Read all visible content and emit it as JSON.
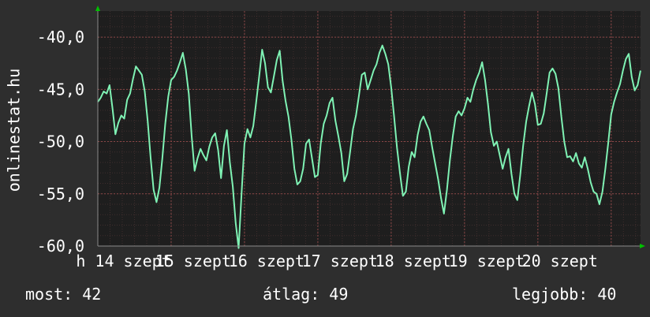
{
  "chart_data": {
    "type": "line",
    "vertical_label": "onlinestat.hu",
    "y_tick_labels": [
      "-40,0",
      "-45,0",
      "-50,0",
      "-55,0",
      "-60,0"
    ],
    "x_tick_labels": [
      "h 14 szept",
      "15 szept",
      "16 szept",
      "17 szept",
      "18 szept",
      "19 szept",
      "20 szept"
    ],
    "ylim": [
      -60,
      -37.5
    ],
    "grid": true,
    "colors": {
      "background": "#2e2e2e",
      "plot": "#1e1e1e",
      "grid": "#5a3b3b",
      "line": "#7ff2b4",
      "text": "#ffffff",
      "axis_arrow": "#00c000"
    },
    "x": [
      0.0,
      0.04,
      0.08,
      0.12,
      0.16,
      0.2,
      0.24,
      0.28,
      0.32,
      0.36,
      0.4,
      0.44,
      0.48,
      0.52,
      0.56,
      0.6,
      0.64,
      0.68,
      0.72,
      0.76,
      0.8,
      0.84,
      0.88,
      0.92,
      0.96,
      1.0,
      1.04,
      1.08,
      1.12,
      1.16,
      1.2,
      1.24,
      1.28,
      1.32,
      1.36,
      1.4,
      1.44,
      1.48,
      1.52,
      1.56,
      1.6,
      1.64,
      1.68,
      1.72,
      1.76,
      1.8,
      1.84,
      1.88,
      1.92,
      1.96,
      2.0,
      2.04,
      2.08,
      2.12,
      2.16,
      2.2,
      2.24,
      2.28,
      2.32,
      2.36,
      2.4,
      2.44,
      2.48,
      2.52,
      2.56,
      2.6,
      2.64,
      2.68,
      2.72,
      2.76,
      2.8,
      2.84,
      2.88,
      2.92,
      2.96,
      3.0,
      3.04,
      3.08,
      3.12,
      3.16,
      3.2,
      3.24,
      3.28,
      3.32,
      3.36,
      3.4,
      3.44,
      3.48,
      3.52,
      3.56,
      3.6,
      3.64,
      3.68,
      3.72,
      3.76,
      3.8,
      3.84,
      3.88,
      3.92,
      3.96,
      4.0,
      4.04,
      4.08,
      4.12,
      4.16,
      4.2,
      4.24,
      4.28,
      4.32,
      4.36,
      4.4,
      4.44,
      4.48,
      4.52,
      4.56,
      4.6,
      4.64,
      4.68,
      4.72,
      4.76,
      4.8,
      4.84,
      4.88,
      4.92,
      4.96,
      5.0,
      5.04,
      5.08,
      5.12,
      5.16,
      5.2,
      5.24,
      5.28,
      5.32,
      5.36,
      5.4,
      5.44,
      5.48,
      5.52,
      5.56,
      5.6,
      5.64,
      5.68,
      5.72,
      5.76,
      5.8,
      5.84,
      5.88,
      5.92,
      5.96,
      6.0,
      6.04,
      6.08,
      6.12,
      6.16,
      6.2,
      6.24,
      6.28,
      6.32,
      6.36,
      6.4,
      6.44,
      6.48,
      6.52,
      6.56,
      6.6,
      6.64,
      6.68,
      6.72,
      6.76,
      6.8,
      6.84,
      6.88,
      6.92,
      6.96,
      7.0,
      7.04,
      7.08,
      7.12,
      7.16,
      7.2,
      7.24,
      7.28,
      7.32,
      7.36,
      7.4
    ],
    "y": [
      -46.2,
      -45.8,
      -45.2,
      -45.4,
      -44.6,
      -46.8,
      -49.3,
      -48.2,
      -47.5,
      -47.8,
      -46.0,
      -45.4,
      -44.0,
      -42.8,
      -43.2,
      -43.6,
      -45.2,
      -48.0,
      -51.5,
      -54.6,
      -55.8,
      -54.4,
      -51.6,
      -48.3,
      -45.7,
      -44.1,
      -43.8,
      -43.2,
      -42.4,
      -41.5,
      -43.1,
      -45.4,
      -49.5,
      -52.8,
      -51.6,
      -50.7,
      -51.3,
      -51.8,
      -50.5,
      -49.6,
      -49.2,
      -50.8,
      -53.5,
      -50.4,
      -48.9,
      -52.0,
      -54.3,
      -57.8,
      -60.2,
      -55.0,
      -50.2,
      -48.8,
      -49.6,
      -48.5,
      -46.2,
      -43.8,
      -41.2,
      -42.5,
      -44.8,
      -45.3,
      -43.8,
      -42.2,
      -41.3,
      -44.2,
      -46.1,
      -47.6,
      -49.8,
      -52.6,
      -54.1,
      -53.8,
      -52.6,
      -50.2,
      -49.8,
      -51.6,
      -53.4,
      -53.2,
      -50.2,
      -48.3,
      -47.5,
      -46.3,
      -45.8,
      -48.0,
      -49.5,
      -51.1,
      -53.8,
      -53.1,
      -51.0,
      -48.8,
      -47.5,
      -45.6,
      -43.6,
      -43.4,
      -45.0,
      -44.1,
      -43.2,
      -42.6,
      -41.5,
      -40.8,
      -41.6,
      -42.6,
      -44.8,
      -47.6,
      -50.6,
      -53.0,
      -55.2,
      -54.8,
      -52.4,
      -51.0,
      -51.5,
      -49.4,
      -48.1,
      -47.6,
      -48.3,
      -48.9,
      -50.6,
      -52.1,
      -53.6,
      -55.4,
      -56.9,
      -54.6,
      -51.8,
      -49.5,
      -47.6,
      -47.1,
      -47.5,
      -46.8,
      -45.8,
      -46.2,
      -45.0,
      -44.1,
      -43.4,
      -42.4,
      -44.1,
      -46.4,
      -49.1,
      -50.4,
      -50.0,
      -51.3,
      -52.6,
      -51.5,
      -50.7,
      -53.1,
      -55.0,
      -55.6,
      -53.2,
      -50.4,
      -48.1,
      -46.6,
      -45.3,
      -46.4,
      -48.4,
      -48.3,
      -47.3,
      -45.4,
      -43.4,
      -43.0,
      -43.5,
      -44.9,
      -47.6,
      -50.0,
      -51.5,
      -51.4,
      -51.9,
      -51.1,
      -52.1,
      -52.5,
      -51.5,
      -52.6,
      -53.9,
      -54.8,
      -55.0,
      -56.0,
      -54.8,
      -52.6,
      -50.1,
      -47.4,
      -46.2,
      -45.3,
      -44.5,
      -43.2,
      -42.1,
      -41.6,
      -43.8,
      -45.1,
      -44.6,
      -43.2,
      -44.2,
      -46.4,
      -48.8,
      -51.7,
      -54.4,
      -53.8,
      -52.4,
      -52.6,
      -53.7,
      -54.6,
      -55.6,
      -54.0,
      -52.6,
      -54.1,
      -55.4,
      -56.5,
      -54.4,
      -48.6,
      -45.0,
      -42.5,
      -39.8,
      -41.4,
      -41.6
    ]
  },
  "stats": {
    "now": "most: 42",
    "avg": "átlag: 49",
    "best": "legjobb: 40"
  }
}
